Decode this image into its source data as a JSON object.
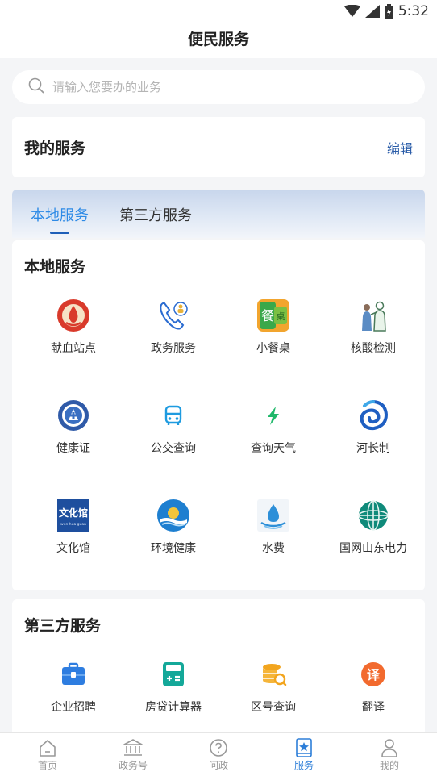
{
  "status_bar": {
    "time": "5:32"
  },
  "header": {
    "title": "便民服务"
  },
  "search": {
    "placeholder": "请输入您要办的业务"
  },
  "my_services": {
    "title": "我的服务",
    "edit_label": "编辑"
  },
  "tabs": [
    {
      "label": "本地服务",
      "active": true
    },
    {
      "label": "第三方服务",
      "active": false
    }
  ],
  "local_services": {
    "title": "本地服务",
    "items": [
      {
        "label": "献血站点",
        "icon": "blood-donation-icon"
      },
      {
        "label": "政务服务",
        "icon": "phone-service-icon"
      },
      {
        "label": "小餐桌",
        "icon": "small-dining-table-icon"
      },
      {
        "label": "核酸检测",
        "icon": "nucleic-acid-test-icon"
      },
      {
        "label": "健康证",
        "icon": "health-certificate-icon"
      },
      {
        "label": "公交查询",
        "icon": "bus-icon"
      },
      {
        "label": "查询天气",
        "icon": "lightning-icon"
      },
      {
        "label": "河长制",
        "icon": "river-swirl-icon"
      },
      {
        "label": "文化馆",
        "icon": "culture-center-icon",
        "icon_text": "文化馆",
        "icon_subtext": "wen hua guan"
      },
      {
        "label": "环境健康",
        "icon": "environment-health-icon"
      },
      {
        "label": "水费",
        "icon": "water-drop-icon"
      },
      {
        "label": "国网山东电力",
        "icon": "state-grid-icon"
      }
    ]
  },
  "third_party_services": {
    "title": "第三方服务",
    "items": [
      {
        "label": "企业招聘",
        "icon": "briefcase-icon"
      },
      {
        "label": "房贷计算器",
        "icon": "calculator-icon"
      },
      {
        "label": "区号查询",
        "icon": "coin-search-icon"
      },
      {
        "label": "翻译",
        "icon": "translate-icon",
        "icon_text": "译"
      }
    ]
  },
  "bottom_nav": [
    {
      "label": "首页",
      "icon": "home-icon",
      "active": false
    },
    {
      "label": "政务号",
      "icon": "government-building-icon",
      "active": false
    },
    {
      "label": "问政",
      "icon": "question-icon",
      "active": false
    },
    {
      "label": "服务",
      "icon": "service-star-icon",
      "active": true
    },
    {
      "label": "我的",
      "icon": "user-icon",
      "active": false
    }
  ],
  "colors": {
    "accent_blue": "#2d8ae6",
    "edit_blue": "#2a5ca8",
    "nav_active": "#2d7ed8",
    "background": "#f4f5f7"
  }
}
